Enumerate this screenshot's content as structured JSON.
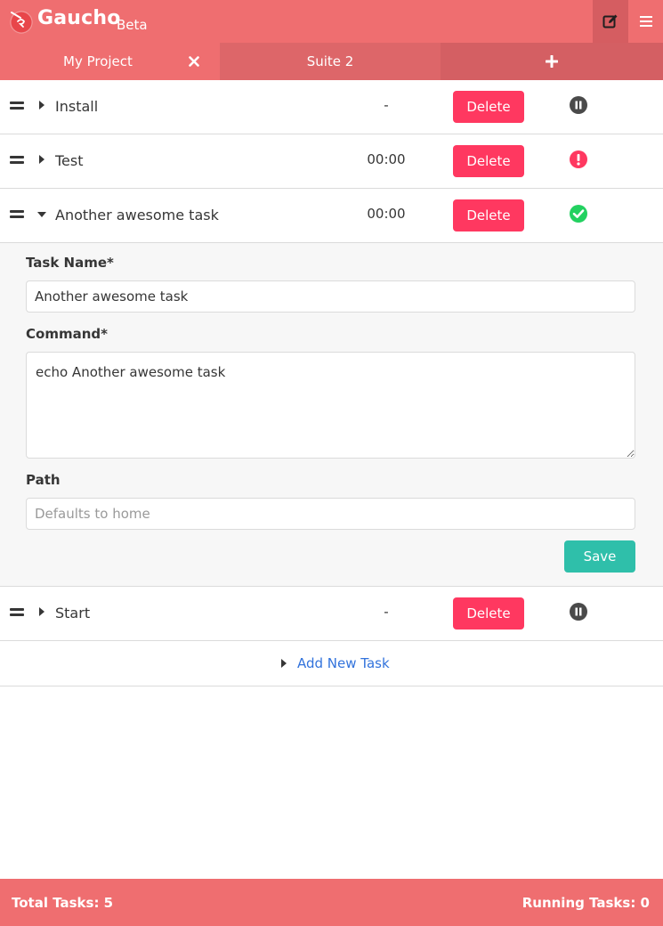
{
  "app": {
    "name": "Gaucho",
    "tag": "Beta"
  },
  "tabs": [
    {
      "label": "My Project",
      "active": true
    },
    {
      "label": "Suite 2",
      "active": false
    }
  ],
  "tasks": [
    {
      "name": "Install",
      "time": "-",
      "delete_label": "Delete",
      "status": "paused"
    },
    {
      "name": "Test",
      "time": "00:00",
      "delete_label": "Delete",
      "status": "error"
    },
    {
      "name": "Another awesome task",
      "time": "00:00",
      "delete_label": "Delete",
      "status": "success",
      "expanded": true
    },
    {
      "name": "Start",
      "time": "-",
      "delete_label": "Delete",
      "status": "paused"
    }
  ],
  "edit_form": {
    "task_name_label": "Task Name*",
    "task_name_value": "Another awesome task",
    "command_label": "Command*",
    "command_value": "echo Another awesome task",
    "path_label": "Path",
    "path_placeholder": "Defaults to home",
    "save_label": "Save"
  },
  "add_task": {
    "label": "Add New Task"
  },
  "footer": {
    "total_tasks": "Total Tasks: 5",
    "running_tasks": "Running Tasks: 0"
  },
  "colors": {
    "primary": "#ef6e70",
    "danger": "#ff3860",
    "success": "#23d160",
    "save": "#2fbfaa",
    "link": "#3273dc"
  },
  "icons": {
    "logo": "gaucho-logo",
    "edit": "edit-icon",
    "menu": "hamburger-icon",
    "close": "close-icon",
    "add": "plus-icon",
    "drag": "drag-handle-icon",
    "caret_right": "caret-right-icon",
    "caret_down": "caret-down-icon",
    "paused": "pause-circle-icon",
    "error": "exclamation-circle-icon",
    "success": "check-circle-icon"
  }
}
